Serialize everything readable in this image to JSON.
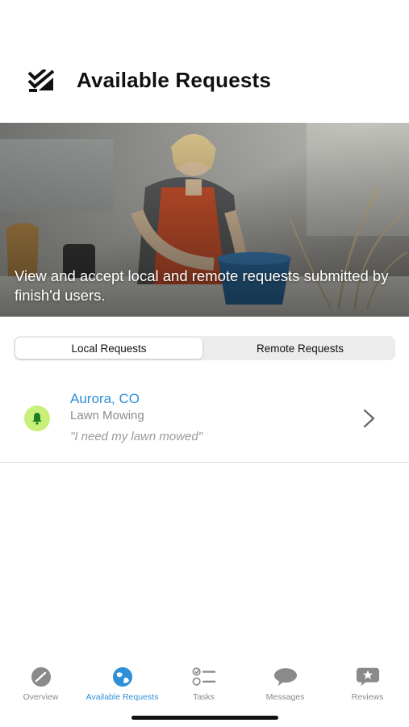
{
  "header": {
    "title": "Available Requests",
    "logo_icon": "checklist-logo-icon"
  },
  "hero": {
    "text": "View and accept local and remote requests submitted by finish'd users."
  },
  "segmented": {
    "tabs": [
      {
        "label": "Local Requests",
        "selected": true
      },
      {
        "label": "Remote Requests",
        "selected": false
      }
    ]
  },
  "requests": [
    {
      "location": "Aurora, CO",
      "category": "Lawn Mowing",
      "quote": "\"I need my lawn mowed\"",
      "icon": "bell-icon",
      "icon_bg": "#c9f07a"
    }
  ],
  "tabbar": {
    "tabs": [
      {
        "label": "Overview",
        "icon": "speedometer-icon",
        "active": false
      },
      {
        "label": "Available Requests",
        "icon": "globe-icon",
        "active": true
      },
      {
        "label": "Tasks",
        "icon": "checklist-icon",
        "active": false
      },
      {
        "label": "Messages",
        "icon": "chat-bubbles-icon",
        "active": false
      },
      {
        "label": "Reviews",
        "icon": "star-bubble-icon",
        "active": false
      }
    ]
  },
  "colors": {
    "accent": "#2f8fd8",
    "inactive_tab": "#8a8a8a",
    "bell_bg": "#c9f07a"
  }
}
